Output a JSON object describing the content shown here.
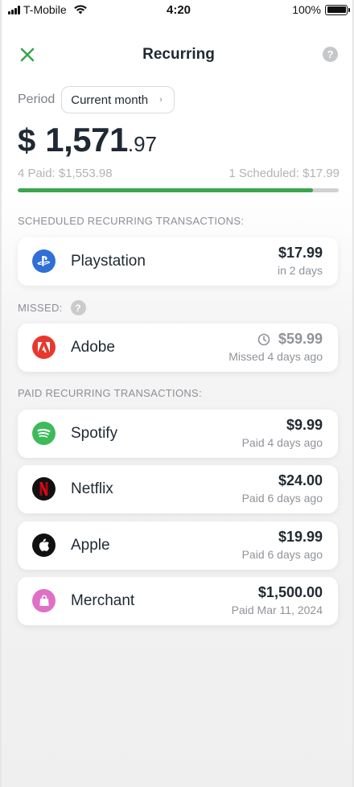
{
  "status_bar": {
    "carrier": "T-Mobile",
    "time": "4:20",
    "battery": "100%"
  },
  "header": {
    "title": "Recurring",
    "close_icon": "close-icon",
    "help_icon": "?"
  },
  "period": {
    "label": "Period",
    "value": "Current month",
    "chevron": "›"
  },
  "total": {
    "currency": "$",
    "main": "1,571",
    "cents": ".97"
  },
  "summary": {
    "paid": "4 Paid: $1,553.98",
    "scheduled": "1 Scheduled: $17.99",
    "progress_fraction": 0.92
  },
  "sections": {
    "scheduled": "SCHEDULED RECURRING TRANSACTIONS:",
    "missed": "MISSED:",
    "missed_help": "?",
    "paid": "PAID RECURRING TRANSACTIONS:"
  },
  "scheduled_items": [
    {
      "name": "Playstation",
      "amount": "$17.99",
      "sub": "in 2 days",
      "icon": "playstation-icon",
      "color": "#2f6fd6"
    }
  ],
  "missed_items": [
    {
      "name": "Adobe",
      "amount": "$59.99",
      "sub": "Missed 4 days ago",
      "icon": "adobe-icon",
      "color": "#e8382d"
    }
  ],
  "paid_items": [
    {
      "name": "Spotify",
      "amount": "$9.99",
      "sub": "Paid 4 days ago",
      "icon": "spotify-icon",
      "color": "#3dba5a"
    },
    {
      "name": "Netflix",
      "amount": "$24.00",
      "sub": "Paid 6 days ago",
      "icon": "netflix-icon",
      "color": "#111111"
    },
    {
      "name": "Apple",
      "amount": "$19.99",
      "sub": "Paid 6 days ago",
      "icon": "apple-icon",
      "color": "#111111"
    },
    {
      "name": "Merchant",
      "amount": "$1,500.00",
      "sub": "Paid Mar 11, 2024",
      "icon": "shopping-bag-icon",
      "color": "#e070c6"
    }
  ],
  "colors": {
    "accent_green": "#3aa54d",
    "text_dark": "#1f2933",
    "text_muted": "#8f9398"
  }
}
